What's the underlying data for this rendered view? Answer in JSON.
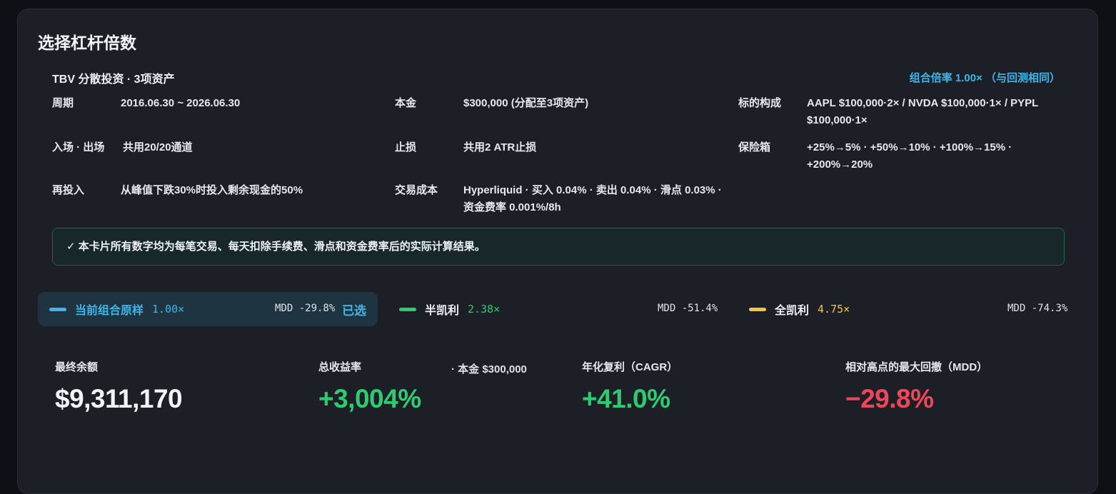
{
  "title": "选择杠杆倍数",
  "strategy": {
    "name": "TBV 分散投资 · 3项资产",
    "ratio_tag": "组合倍率 1.00× （与回测相同）"
  },
  "params": {
    "period_k": "周期",
    "period_v": "2016.06.30 ~ 2026.06.30",
    "principal_k": "本金",
    "principal_v": "$300,000 (分配至3项资产)",
    "assets_k": "标的构成",
    "assets_v": "AAPL $100,000·2× / NVDA $100,000·1× / PYPL $100,000·1×",
    "entry_k": "入场 · 出场",
    "entry_v": "共用20/20通道",
    "stop_k": "止损",
    "stop_v": "共用2 ATR止损",
    "vault_k": "保险箱",
    "vault_v": "+25%→5% · +50%→10% · +100%→15% · +200%→20%",
    "reinvest_k": "再投入",
    "reinvest_v": "从峰值下跌30%时投入剩余现金的50%",
    "cost_k": "交易成本",
    "cost_v": "Hyperliquid · 买入 0.04% · 卖出 0.04% · 滑点 0.03% · 资金费率 0.001%/8h"
  },
  "notice": "✓ 本卡片所有数字均为每笔交易、每天扣除手续费、滑点和资金费率后的实际计算结果。",
  "leverage_options": [
    {
      "name": "当前组合原样",
      "multiplier": "1.00×",
      "mdd": "MDD -29.8%",
      "selected_label": "已选",
      "color": "#3fb6ea"
    },
    {
      "name": "半凯利",
      "multiplier": "2.38×",
      "mdd": "MDD -51.4%",
      "color": "#2ecc71"
    },
    {
      "name": "全凯利",
      "multiplier": "4.75×",
      "mdd": "MDD -74.3%",
      "color": "#f4c542"
    }
  ],
  "stats": {
    "final_label": "最终余额",
    "final_value": "$9,311,170",
    "return_label": "总收益率",
    "return_sub": "· 本金 $300,000",
    "return_value": "+3,004%",
    "cagr_label": "年化复利（CAGR）",
    "cagr_value": "+41.0%",
    "mdd_label": "相对高点的最大回撤（MDD）",
    "mdd_value": "−29.8%"
  }
}
